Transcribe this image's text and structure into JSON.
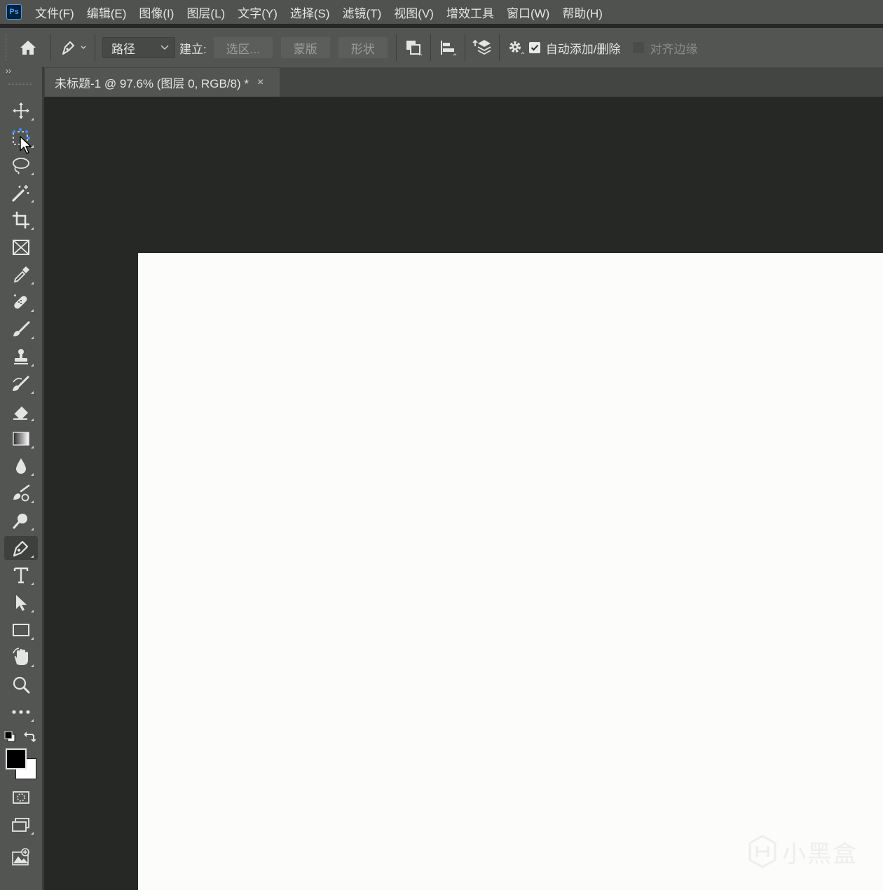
{
  "app": {
    "logo_text": "Ps"
  },
  "menu": [
    "文件(F)",
    "编辑(E)",
    "图像(I)",
    "图层(L)",
    "文字(Y)",
    "选择(S)",
    "滤镜(T)",
    "视图(V)",
    "增效工具",
    "窗口(W)",
    "帮助(H)"
  ],
  "options": {
    "mode_value": "路径",
    "make_label": "建立:",
    "selection_btn": "选区...",
    "mask_btn": "蒙版",
    "shape_btn": "形状",
    "auto_add_label": "自动添加/删除",
    "auto_add_checked": true,
    "align_edges_label": "对齐边缘",
    "align_edges_checked": false
  },
  "toolbar": {
    "collapse_glyph": "››",
    "active_tool": "pen-tool"
  },
  "document": {
    "tab_title": "未标题-1 @ 97.6% (图层 0, RGB/8) *",
    "close_glyph": "×"
  },
  "colors": {
    "foreground": "#000000",
    "background": "#ffffff",
    "canvas": "#fcfdfb"
  },
  "watermark": {
    "text": "小黑盒"
  }
}
